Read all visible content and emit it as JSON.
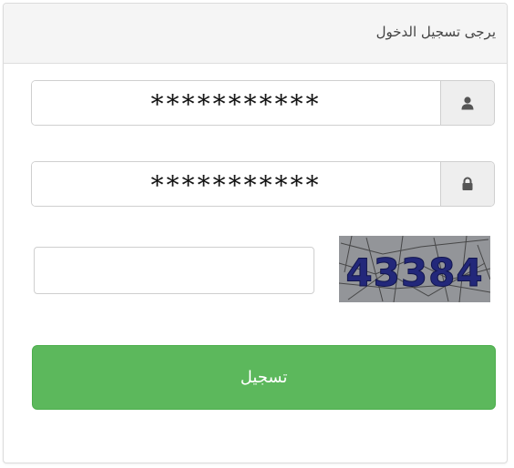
{
  "panel": {
    "title": "يرجى تسجيل الدخول"
  },
  "username": {
    "value": "***********",
    "icon": "user-icon"
  },
  "password": {
    "value": "***********",
    "icon": "lock-icon"
  },
  "captcha": {
    "input_value": "",
    "image_text": "43384"
  },
  "submit": {
    "label": "تسجيل",
    "color": "#5cb85c"
  }
}
